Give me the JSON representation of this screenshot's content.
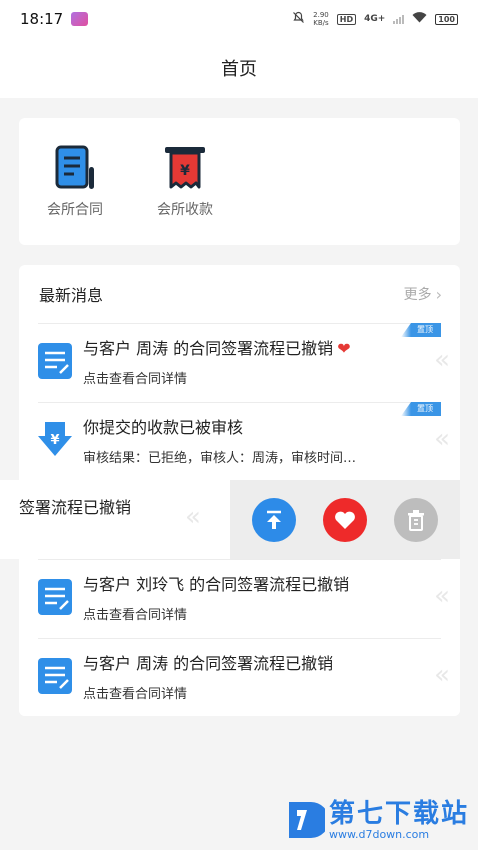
{
  "status_bar": {
    "time": "18:17",
    "net_speed_value": "2.90",
    "net_speed_unit": "KB/s",
    "hd": "HD",
    "network": "4G+",
    "battery": "100"
  },
  "header": {
    "title": "首页"
  },
  "quick_actions": [
    {
      "label": "会所合同",
      "icon": "contract-icon"
    },
    {
      "label": "会所收款",
      "icon": "receipt-icon"
    }
  ],
  "news": {
    "title": "最新消息",
    "more_label": "更多",
    "pin_label": "置顶",
    "items": [
      {
        "title": "与客户 周涛 的合同签署流程已撤销",
        "subtitle": "点击查看合同详情",
        "pinned": true,
        "favorite": true,
        "icon": "document-icon"
      },
      {
        "title": "你提交的收款已被审核",
        "subtitle": "审核结果：已拒绝，审核人：周涛，审核时间…",
        "pinned": true,
        "icon": "yuan-download-icon"
      },
      {
        "title": "签署流程已撤销",
        "swiped": true
      },
      {
        "title": "与客户 刘玲飞 的合同签署流程已撤销",
        "subtitle": "点击查看合同详情",
        "icon": "document-icon"
      },
      {
        "title": "与客户 周涛 的合同签署流程已撤销",
        "subtitle": "点击查看合同详情",
        "icon": "document-icon"
      }
    ],
    "swipe_actions": [
      "pin-top-icon",
      "heart-icon",
      "trash-icon"
    ]
  },
  "footer": {
    "name": "第七下载站",
    "url": "www.d7down.com"
  },
  "colors": {
    "accent": "#2d8be8",
    "favorite": "#ee2a2a",
    "delete": "#bdbdbd",
    "doc_icon": "#2f8fe8"
  }
}
